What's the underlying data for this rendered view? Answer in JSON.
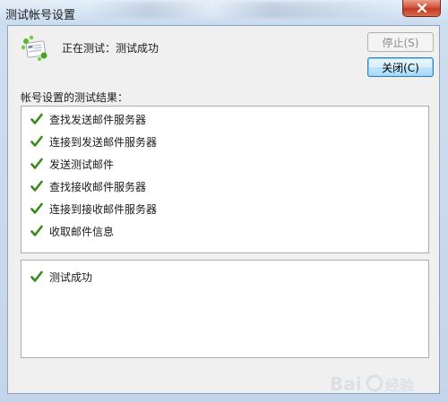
{
  "window": {
    "title": "测试帐号设置"
  },
  "status": {
    "text": "正在测试：测试成功"
  },
  "buttons": {
    "stop": "停止(S)",
    "close": "关闭(C)"
  },
  "section_label": "帐号设置的测试结果：",
  "tasks": [
    {
      "label": "查找发送邮件服务器",
      "status": "success"
    },
    {
      "label": "连接到发送邮件服务器",
      "status": "success"
    },
    {
      "label": "发送测试邮件",
      "status": "success"
    },
    {
      "label": "查找接收邮件服务器",
      "status": "success"
    },
    {
      "label": "连接到接收邮件服务器",
      "status": "success"
    },
    {
      "label": "收取邮件信息",
      "status": "success"
    }
  ],
  "result": {
    "label": "测试成功",
    "status": "success"
  },
  "icons": {
    "check": "check-icon",
    "status": "account-settings-icon",
    "window_close": "close-icon"
  },
  "colors": {
    "check_green": "#3a8a1e",
    "close_red": "#c23d22"
  }
}
